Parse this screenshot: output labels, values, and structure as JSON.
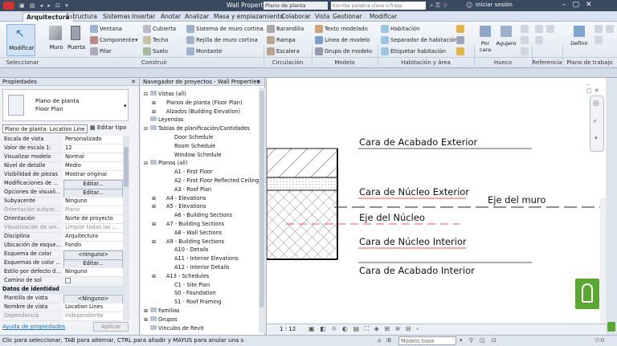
{
  "title_bar": {
    "doc_title": "Wall Properties",
    "search_placeholder": "Escriba palabra clave o frase",
    "search_left": "Plano de planta",
    "signin": "Iniciar sesión"
  },
  "tabs": [
    "Arquitectura",
    "Estructura",
    "Sistemas",
    "Insertar",
    "Anotar",
    "Analizar",
    "Masa y emplazamiento",
    "Colaborar",
    "Vista",
    "Gestionar",
    "Modificar"
  ],
  "ribbon": {
    "modify": "Modificar",
    "wall": "Muro",
    "door": "Puerta",
    "window": "Ventana",
    "component": "Componente",
    "column": "Pilar",
    "roof": "Cubierta",
    "ceiling": "Techo",
    "floor": "Suelo",
    "curtain_system": "Sistema de muro cortina",
    "curtain_grid": "Rejilla de muro cortina",
    "mullion": "Montante",
    "railing": "Barandilla",
    "ramp": "Rampa",
    "stair": "Escalera",
    "model_text": "Texto modelado",
    "model_line": "Línea de modelo",
    "model_group": "Grupo de modelo",
    "room": "Habitación",
    "room_separator": "Separador de habitación",
    "tag_room": "Etiquetar habitación",
    "by_face": "Por cara",
    "shaft": "Agujero",
    "define": "Definir",
    "groups": {
      "select": "Seleccionar",
      "build": "Construir",
      "circulation": "Circulación",
      "model": "Modelo",
      "room": "Habitación y área",
      "opening": "Hueco",
      "datum": "Referencia",
      "workplane": "Plano de trabajo"
    }
  },
  "properties": {
    "header": "Propiedades",
    "type_name": "Plano de planta",
    "type_sub": "Floor Plan",
    "selector": "Plano de planta: Location Line",
    "edit_type": "Editar tipo",
    "rows": [
      {
        "k": "Escala de vista",
        "v": "Personalizado",
        "kind": "val"
      },
      {
        "k": "Valor de escala    1:",
        "v": "12",
        "kind": "val"
      },
      {
        "k": "Visualizar modelo",
        "v": "Normal",
        "kind": "val"
      },
      {
        "k": "Nivel de detalle",
        "v": "Medio",
        "kind": "val"
      },
      {
        "k": "Visibilidad de piezas",
        "v": "Mostrar original",
        "kind": "val"
      },
      {
        "k": "Modificaciones de ...",
        "v": "Editar...",
        "kind": "btn"
      },
      {
        "k": "Opciones de visuali...",
        "v": "Editar...",
        "kind": "btn"
      },
      {
        "k": "Subyacente",
        "v": "Ninguno",
        "kind": "val"
      },
      {
        "k": "Orientación subyac...",
        "v": "Plano",
        "kind": "dis"
      },
      {
        "k": "Orientación",
        "v": "Norte de proyecto",
        "kind": "val"
      },
      {
        "k": "Visualización de uni...",
        "v": "Limpiar todas las ...",
        "kind": "dis"
      },
      {
        "k": "Disciplina",
        "v": "Arquitectura",
        "kind": "val"
      },
      {
        "k": "Ubicación de esque...",
        "v": "Fondo",
        "kind": "val"
      },
      {
        "k": "Esquema de color",
        "v": "<ninguno>",
        "kind": "btn"
      },
      {
        "k": "Esquemas de color ...",
        "v": "Editar...",
        "kind": "btn"
      },
      {
        "k": "Estilo por defecto d...",
        "v": "Ninguno",
        "kind": "val"
      },
      {
        "k": "Camino de sol",
        "v": "",
        "kind": "chk"
      }
    ],
    "section": "Datos de identidad",
    "rows2": [
      {
        "k": "Plantilla de vista",
        "v": "<Ninguno>",
        "kind": "btn"
      },
      {
        "k": "Nombre de vista",
        "v": "Location Lines",
        "kind": "val"
      },
      {
        "k": "Dependencia",
        "v": "Independiente",
        "kind": "dis"
      }
    ],
    "help": "Ayuda de propiedades",
    "apply": "Aplicar"
  },
  "browser": {
    "header": "Navegador de proyectos - Wall Properties",
    "nodes": [
      {
        "t": "Vistas (all)",
        "lvl": 0,
        "ex": "−"
      },
      {
        "t": "Planos de planta (Floor Plan)",
        "lvl": 1,
        "ex": "+"
      },
      {
        "t": "Alzados (Building Elevation)",
        "lvl": 1,
        "ex": "+"
      },
      {
        "t": "Leyendas",
        "lvl": 0,
        "ex": ""
      },
      {
        "t": "Tablas de planificación/Cantidades",
        "lvl": 0,
        "ex": "−"
      },
      {
        "t": "Door Schedule",
        "lvl": 2,
        "ex": ""
      },
      {
        "t": "Room Schedule",
        "lvl": 2,
        "ex": ""
      },
      {
        "t": "Window Schedule",
        "lvl": 2,
        "ex": ""
      },
      {
        "t": "Planos (all)",
        "lvl": 0,
        "ex": "−"
      },
      {
        "t": "A1 - First Floor",
        "lvl": 2,
        "ex": ""
      },
      {
        "t": "A2 - First Floor Reflected Ceiling Plan",
        "lvl": 2,
        "ex": ""
      },
      {
        "t": "A3 - Roof Plan",
        "lvl": 2,
        "ex": ""
      },
      {
        "t": "A4 - Elevations",
        "lvl": 1,
        "ex": "+"
      },
      {
        "t": "A5 - Elevations",
        "lvl": 1,
        "ex": "+"
      },
      {
        "t": "A6 - Building Sections",
        "lvl": 2,
        "ex": ""
      },
      {
        "t": "A7 - Building Sections",
        "lvl": 1,
        "ex": "+"
      },
      {
        "t": "A8 - Wall Sections",
        "lvl": 2,
        "ex": ""
      },
      {
        "t": "A9 - Building Sections",
        "lvl": 1,
        "ex": "+"
      },
      {
        "t": "A10 - Details",
        "lvl": 2,
        "ex": ""
      },
      {
        "t": "A11 - Interior Elevations",
        "lvl": 2,
        "ex": ""
      },
      {
        "t": "A12 - Interior Details",
        "lvl": 2,
        "ex": ""
      },
      {
        "t": "A13 - Schedules",
        "lvl": 1,
        "ex": "+"
      },
      {
        "t": "C1 - Site Plan",
        "lvl": 2,
        "ex": ""
      },
      {
        "t": "S0 - Foundation",
        "lvl": 2,
        "ex": ""
      },
      {
        "t": "S1 - Roof Framing",
        "lvl": 2,
        "ex": ""
      },
      {
        "t": "Familias",
        "lvl": 0,
        "ex": "+"
      },
      {
        "t": "Grupos",
        "lvl": 0,
        "ex": "+"
      },
      {
        "t": "Vínculos de Revit",
        "lvl": 0,
        "ex": ""
      }
    ]
  },
  "view": {
    "labels": {
      "ext_finish": "Cara de Acabado Exterior",
      "ext_core": "Cara de Núcleo Exterior",
      "wall_axis": "Eje del muro",
      "core_axis": "Eje del Núcleo",
      "int_core": "Cara de Núcleo Interior",
      "int_finish": "Cara de Acabado Interior"
    },
    "scale": "1 : 12"
  },
  "status": {
    "text": "Clic para seleccionar, TAB para alternar, CTRL para añadir y MAYÚS para anular una selecció",
    "coord": ":0",
    "model": "Modelo base"
  },
  "colors": {
    "accent": "#1e6fc8",
    "logo_green": "#5aa832",
    "dim_red": "#d22"
  }
}
